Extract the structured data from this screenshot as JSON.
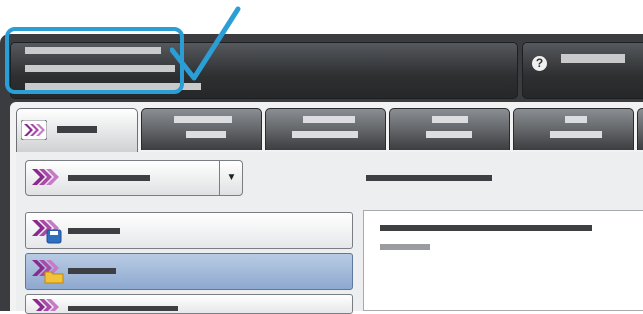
{
  "status_bar": {
    "label": "",
    "status": ""
  },
  "login": {
    "label": "",
    "help_icon": "help-icon"
  },
  "tabs": [
    {
      "label": "",
      "icon": "services-home-icon",
      "active": true
    },
    {
      "label": "",
      "active": false
    },
    {
      "label": "",
      "active": false
    },
    {
      "label": "",
      "active": false
    },
    {
      "label": "",
      "active": false
    }
  ],
  "dropdown": {
    "value": "",
    "icon": "chevron-app-icon"
  },
  "list_items": [
    {
      "label": "",
      "icon": "save-to-disk-icon",
      "selected": false
    },
    {
      "label": "",
      "icon": "folder-icon",
      "selected": true
    },
    {
      "label": "",
      "icon": "chevron-app-icon",
      "selected": false
    }
  ],
  "details": {
    "heading": "",
    "text": ""
  },
  "content_heading": "",
  "annotation": {
    "shape": "blue-rounded-rectangle",
    "mark": "checkmark-icon",
    "color": "#2b9ed6"
  },
  "colors": {
    "accent_purple": "#8a2a8f",
    "highlight_blue": "#2b9ed6",
    "selected_row": "#9fb8da",
    "frame": "#3a3c3f"
  }
}
